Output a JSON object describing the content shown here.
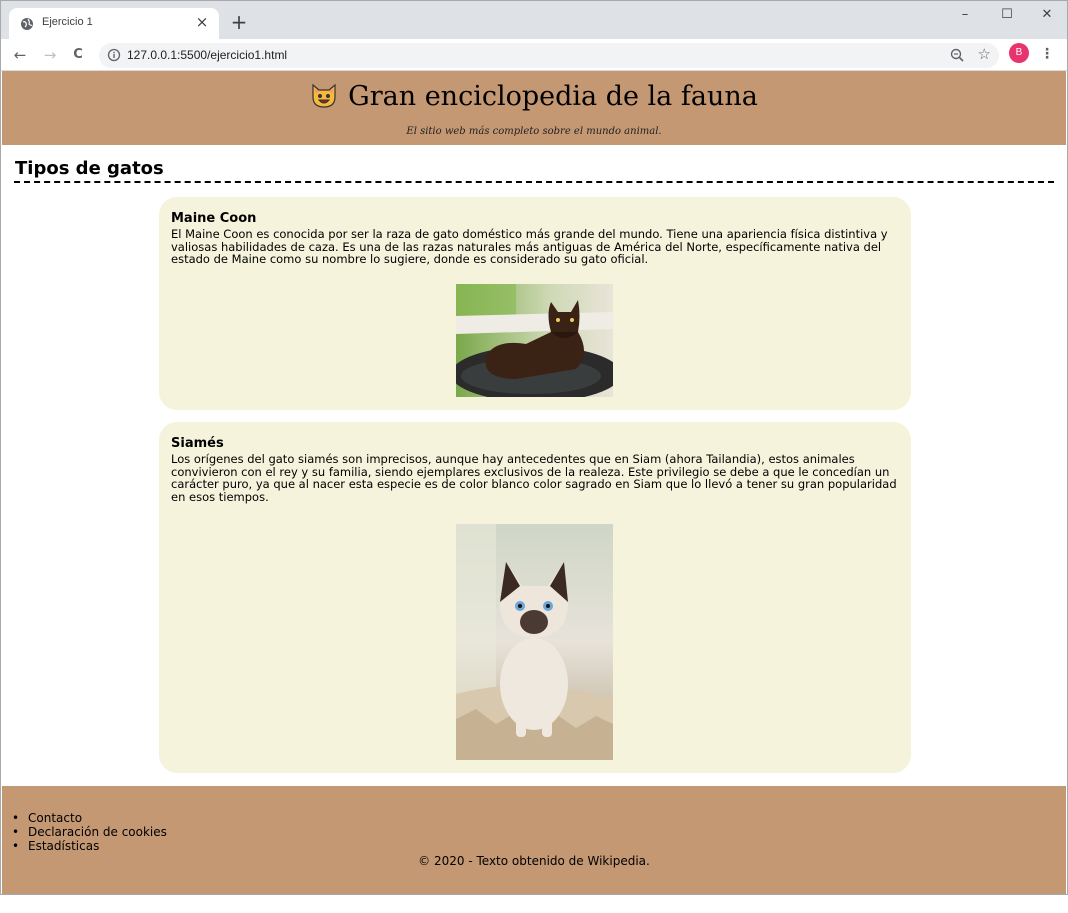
{
  "browser": {
    "tab_title": "Ejercicio 1",
    "tab_close": "×",
    "new_tab": "+",
    "url": "127.0.0.1:5500/ejercicio1.html",
    "avatar_letter": "B",
    "window_controls": {
      "minimize": "–",
      "maximize": "☐",
      "close": "✕"
    },
    "nav": {
      "back": "←",
      "forward": "→",
      "reload": "C"
    }
  },
  "header": {
    "title": "Gran enciclopedia de la fauna",
    "tagline": "El sitio web más completo sobre el mundo animal.",
    "emoji_icon": "cat-face-icon"
  },
  "main": {
    "section_title": "Tipos de gatos",
    "cards": [
      {
        "title": "Maine Coon",
        "text": "El Maine Coon es conocida por ser la raza de gato doméstico más grande del mundo. Tiene una apariencia física distintiva y valiosas habilidades de caza. Es una de las razas naturales más antiguas de América del Norte, específicamente nativa del estado de Maine como su nombre lo sugiere, donde es considerado su gato oficial.",
        "image": "maine-coon-photo"
      },
      {
        "title": "Siamés",
        "text": "Los orígenes del gato siamés son imprecisos, aunque hay antecedentes que en Siam (ahora Tailandia), estos animales convivieron con el rey y su familia, siendo ejemplares exclusivos de la realeza. Este privilegio se debe a que le concedían un carácter puro, ya que al nacer esta especie es de color blanco color sagrado en Siam que lo llevó a tener su gran popularidad en esos tiempos.",
        "image": "siamese-kitten-photo"
      }
    ]
  },
  "footer": {
    "links": [
      "Contacto",
      "Declaración de cookies",
      "Estadísticas"
    ],
    "copyright": "© 2020 - Texto obtenido de Wikipedia."
  },
  "colors": {
    "header_bg": "#c49873",
    "card_bg": "#f5f3dc",
    "tabstrip_bg": "#dee1e6",
    "avatar_bg": "#e8336e"
  }
}
